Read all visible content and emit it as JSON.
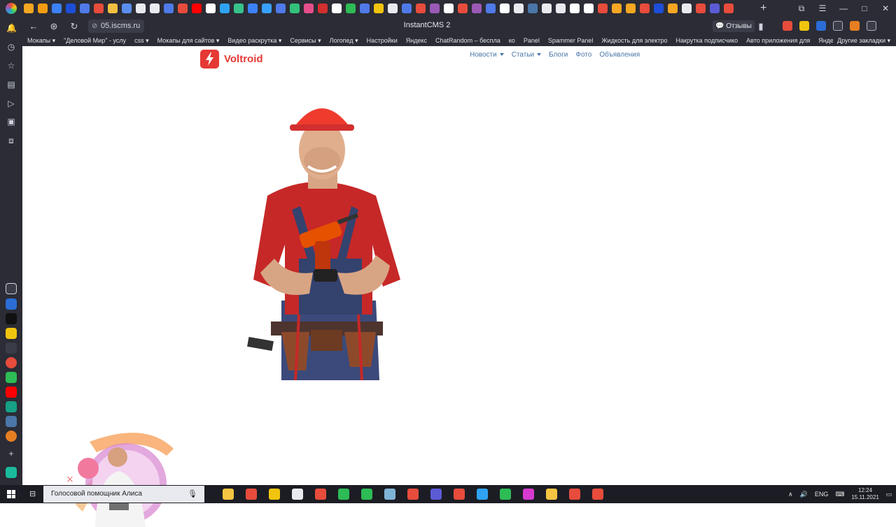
{
  "browser": {
    "title": "InstantCMS 2",
    "url": "05.iscms.ru",
    "reviews_label": "Отзывы",
    "tab_icon_colors": [
      "#f5a623",
      "#f39c12",
      "#3b82f6",
      "#1d4ed8",
      "#4f7ae8",
      "#e74c3c",
      "#f0c040",
      "#5b8def",
      "#e9eaef",
      "#e9eaef",
      "#4f7ae8",
      "#e74c3c",
      "#ff0000",
      "#ffffff",
      "#2fa3f3",
      "#36c28a",
      "#3b82f6",
      "#3aa0ff",
      "#4f7ae8",
      "#33c07a",
      "#e54e8a",
      "#d32f2f",
      "#ffffff",
      "#2dbc55",
      "#4f7ae8",
      "#f1c40f",
      "#e9eaef",
      "#4f7ae8",
      "#e74c3c",
      "#9b59b6",
      "#ffffff",
      "#e74c3c",
      "#9b59b6",
      "#4f7ae8",
      "#ffffff",
      "#e9eaef",
      "#4a76a8",
      "#e9eaef",
      "#e9eaef",
      "#ffffff",
      "#ffffff",
      "#e74c3c",
      "#f5a623",
      "#f5a623",
      "#e74c3c",
      "#1d4ed8",
      "#f5a623",
      "#e9eaef",
      "#e74c3c",
      "#5b5bd6",
      "#e74c3c"
    ]
  },
  "bookmarks": [
    "Мокапы ▾",
    "\"Деловой Мир\" - услу",
    "css ▾",
    "Мокапы для сайтов ▾",
    "Видео раскрутка ▾",
    "Сервисы ▾",
    "Логопед ▾",
    "Настройки",
    "Яндекс",
    "ChatRandom – беспла",
    "ко",
    "Panel",
    "Spammer Panel",
    "Жидкость для электро",
    "Накрутка подписчико",
    "Авто приложения для",
    "Яндекс"
  ],
  "bookmarks_other": "Другие закладки ▾",
  "site": {
    "logo_text": "Voltroid",
    "nav": [
      {
        "label": "Новости",
        "caret": true
      },
      {
        "label": "Статьи",
        "caret": true
      },
      {
        "label": "Блоги",
        "caret": false
      },
      {
        "label": "Фото",
        "caret": false
      },
      {
        "label": "Объявления",
        "caret": false
      }
    ]
  },
  "taskbar": {
    "search_text": "Голосовой помощник Алиса",
    "app_colors": [
      "#f5c542",
      "#e74c3c",
      "#f1c40f",
      "#e9eaef",
      "#e74c3c",
      "#2dbc55",
      "#2dbc55",
      "#7fb3d5",
      "#e74c3c",
      "#5b5bd6",
      "#e74c3c",
      "#2fa3f3",
      "#2dbc55",
      "#d63ad1",
      "#f5c542",
      "#e74c3c",
      "#e74c3c"
    ],
    "lang": "ENG",
    "time": "12:24",
    "date": "15.11.2021"
  }
}
